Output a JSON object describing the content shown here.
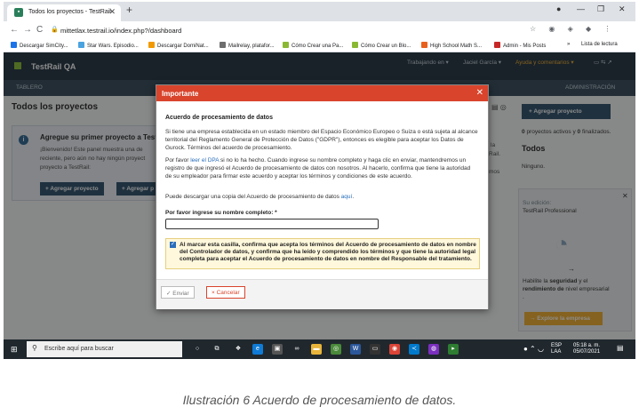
{
  "browser": {
    "tab_title": "Todos los proyectos - TestRail",
    "url": "mittetlax.testrail.io/index.php?/dashboard",
    "bookmarks": [
      {
        "label": "Descargar SimCity...",
        "color": "#1a73e8"
      },
      {
        "label": "Star Wars. Episodio...",
        "color": "#4aa3df"
      },
      {
        "label": "Descargar DomiNat...",
        "color": "#f29900"
      },
      {
        "label": "Mailrelay, platafor...",
        "color": "#6d6d6d"
      },
      {
        "label": "Cómo Crear una Pa...",
        "color": "#8ab833"
      },
      {
        "label": "Cómo Crear un Blo...",
        "color": "#8ab833"
      },
      {
        "label": "High School Math S...",
        "color": "#e8601c"
      },
      {
        "label": "Admin - Mis Posts",
        "color": "#c62828"
      }
    ],
    "reading_list": "Lista de lectura"
  },
  "app": {
    "logo_text": "TestRail QA",
    "header_links": [
      "Trabajando en ▾",
      "Jaciel García ▾",
      "Ayuda y comentarios ▾"
    ],
    "nav_left": "TABLERO",
    "nav_right": "ADMINISTRACIÓN",
    "page_title": "Todos los proyectos",
    "info_heading": "Agregue su primer proyecto a TestR",
    "info_text": "¡Bienvenido! Este panel muestra una de reciente, pero aún no hay ningún proyect proyecto a TestRail:",
    "add_project_button": "+ Agregar proyecto",
    "add_project_button2": "+ Agregar p",
    "mid_snippets": [
      "la",
      "Rail.",
      "mos"
    ],
    "sidebar": {
      "add_project": "+ Agregar proyecto",
      "projects_count_active": "0",
      "projects_count_line": "proyectos activos y",
      "projects_count_finished": "0",
      "finished_label": "finalizados.",
      "todos_heading": "Todos",
      "todos_text": "Ninguno.",
      "edition_label": "Su edición:",
      "edition_value": "TestRail Professional",
      "upgrade_text_pre": "Habilite la",
      "upgrade_bold1": "seguridad",
      "upgrade_text_mid": "y el",
      "upgrade_bold2": "rendimiento de",
      "upgrade_text_post": "nivel empresarial",
      "upgrade_dot": ".",
      "explore_button": "→ Explore la empresa"
    }
  },
  "modal": {
    "title": "Importante",
    "heading": "Acuerdo de procesamiento de datos",
    "para1": "Si tiene una empresa establecida en un estado miembro del Espacio Económico Europeo o Suiza o está sujeta al alcance territorial del Reglamento General de Protección de Datos (\"GDPR\"), entonces es elegible para aceptar los Datos de Gurock. Términos del acuerdo de procesamiento.",
    "para2_pre": "Por favor",
    "para2_link": "leer el DPA",
    "para2_post": "si no lo ha hecho. Cuando ingrese su nombre completo y haga clic en enviar, mantendremos un registro de que ingresó el Acuerdo de procesamiento de datos con nosotros. Al hacerlo, confirma que tiene la autoridad de su empleador para firmar este acuerdo y aceptar los términos y condiciones de este acuerdo.",
    "para3_pre": "Puede descargar una copia del Acuerdo de procesamiento de datos",
    "para3_link": "aquí",
    "para3_post": ".",
    "name_label": "Por favor ingrese su nombre completo: *",
    "name_value": "",
    "consent_text": "Al marcar esta casilla, confirma que acepta los términos del Acuerdo de procesamiento de datos en nombre del Controlador de datos, y confirma que ha leído y comprendido los términos y que tiene la autoridad legal completa para aceptar el Acuerdo de procesamiento de datos en nombre del Responsable del tratamiento.",
    "consent_checked": true,
    "send_button": "✓ Enviar",
    "cancel_button": "× Cancelar"
  },
  "taskbar": {
    "search_placeholder": "Escribe aquí para buscar",
    "lang_top": "ESP",
    "lang_bottom": "LAA",
    "time": "05:18 a. m.",
    "date": "05/07/2021"
  },
  "caption": "Ilustración 6 Acuerdo de procesamiento de datos.",
  "colors": {
    "accent_red": "#d9442c",
    "header_dark": "#2e3f4c",
    "help_orange": "#f3b23a",
    "link_blue": "#2a6ebb"
  }
}
